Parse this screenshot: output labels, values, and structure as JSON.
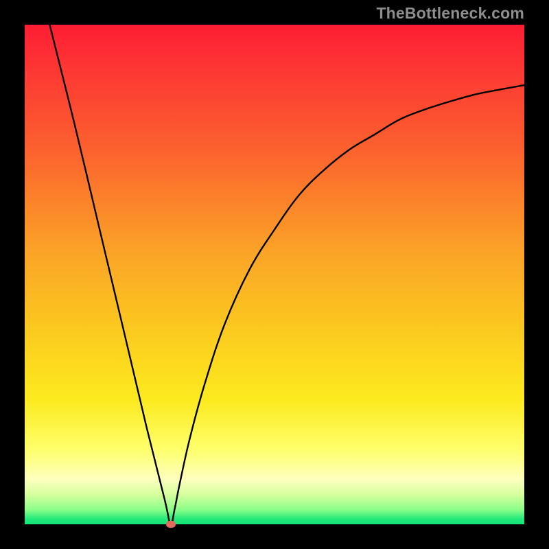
{
  "watermark": "TheBottleneck.com",
  "chart_data": {
    "type": "line",
    "title": "",
    "xlabel": "",
    "ylabel": "",
    "xlim": [
      0,
      1
    ],
    "ylim": [
      0,
      1
    ],
    "background_gradient": {
      "top_color": "#fd1d33",
      "bottom_color": "#13e678",
      "description": "vertical rainbow gradient red→orange→yellow→green indicating bottleneck severity (red high, green low)"
    },
    "series": [
      {
        "name": "bottleneck-curve",
        "description": "V-shaped curve; left branch nearly straight descending steeply, right branch rising with decreasing slope (concave)",
        "x": [
          0.05,
          0.1,
          0.15,
          0.2,
          0.245,
          0.28,
          0.292,
          0.3,
          0.31,
          0.33,
          0.36,
          0.4,
          0.45,
          0.5,
          0.55,
          0.6,
          0.65,
          0.7,
          0.75,
          0.8,
          0.85,
          0.9,
          0.95,
          1.0
        ],
        "y": [
          1.0,
          0.8,
          0.59,
          0.38,
          0.19,
          0.05,
          0.0,
          0.03,
          0.08,
          0.17,
          0.28,
          0.4,
          0.51,
          0.59,
          0.66,
          0.71,
          0.75,
          0.78,
          0.81,
          0.83,
          0.846,
          0.86,
          0.87,
          0.879
        ]
      }
    ],
    "marker": {
      "name": "selected-point",
      "x": 0.292,
      "y": 0.0,
      "color": "#e46a5d"
    }
  }
}
